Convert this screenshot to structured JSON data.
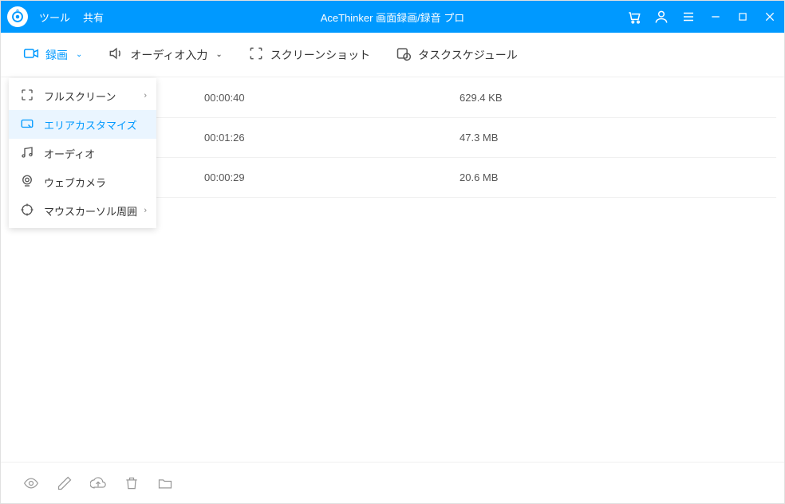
{
  "titlebar": {
    "menu_tools": "ツール",
    "menu_share": "共有",
    "title": "AceThinker 画面録画/録音 プロ"
  },
  "toolbar": {
    "record": "録画",
    "audio_input": "オーディオ入力",
    "screenshot": "スクリーンショット",
    "task_schedule": "タスクスケジュール"
  },
  "dropdown": {
    "fullscreen": "フルスクリーン",
    "area_customize": "エリアカスタマイズ",
    "audio": "オーディオ",
    "webcam": "ウェブカメラ",
    "mouse_cursor_area": "マウスカーソル周囲"
  },
  "rows": [
    {
      "duration": "00:00:40",
      "size": "629.4 KB"
    },
    {
      "duration": "00:01:26",
      "size": "47.3 MB"
    },
    {
      "duration": "00:00:29",
      "size": "20.6 MB"
    }
  ]
}
